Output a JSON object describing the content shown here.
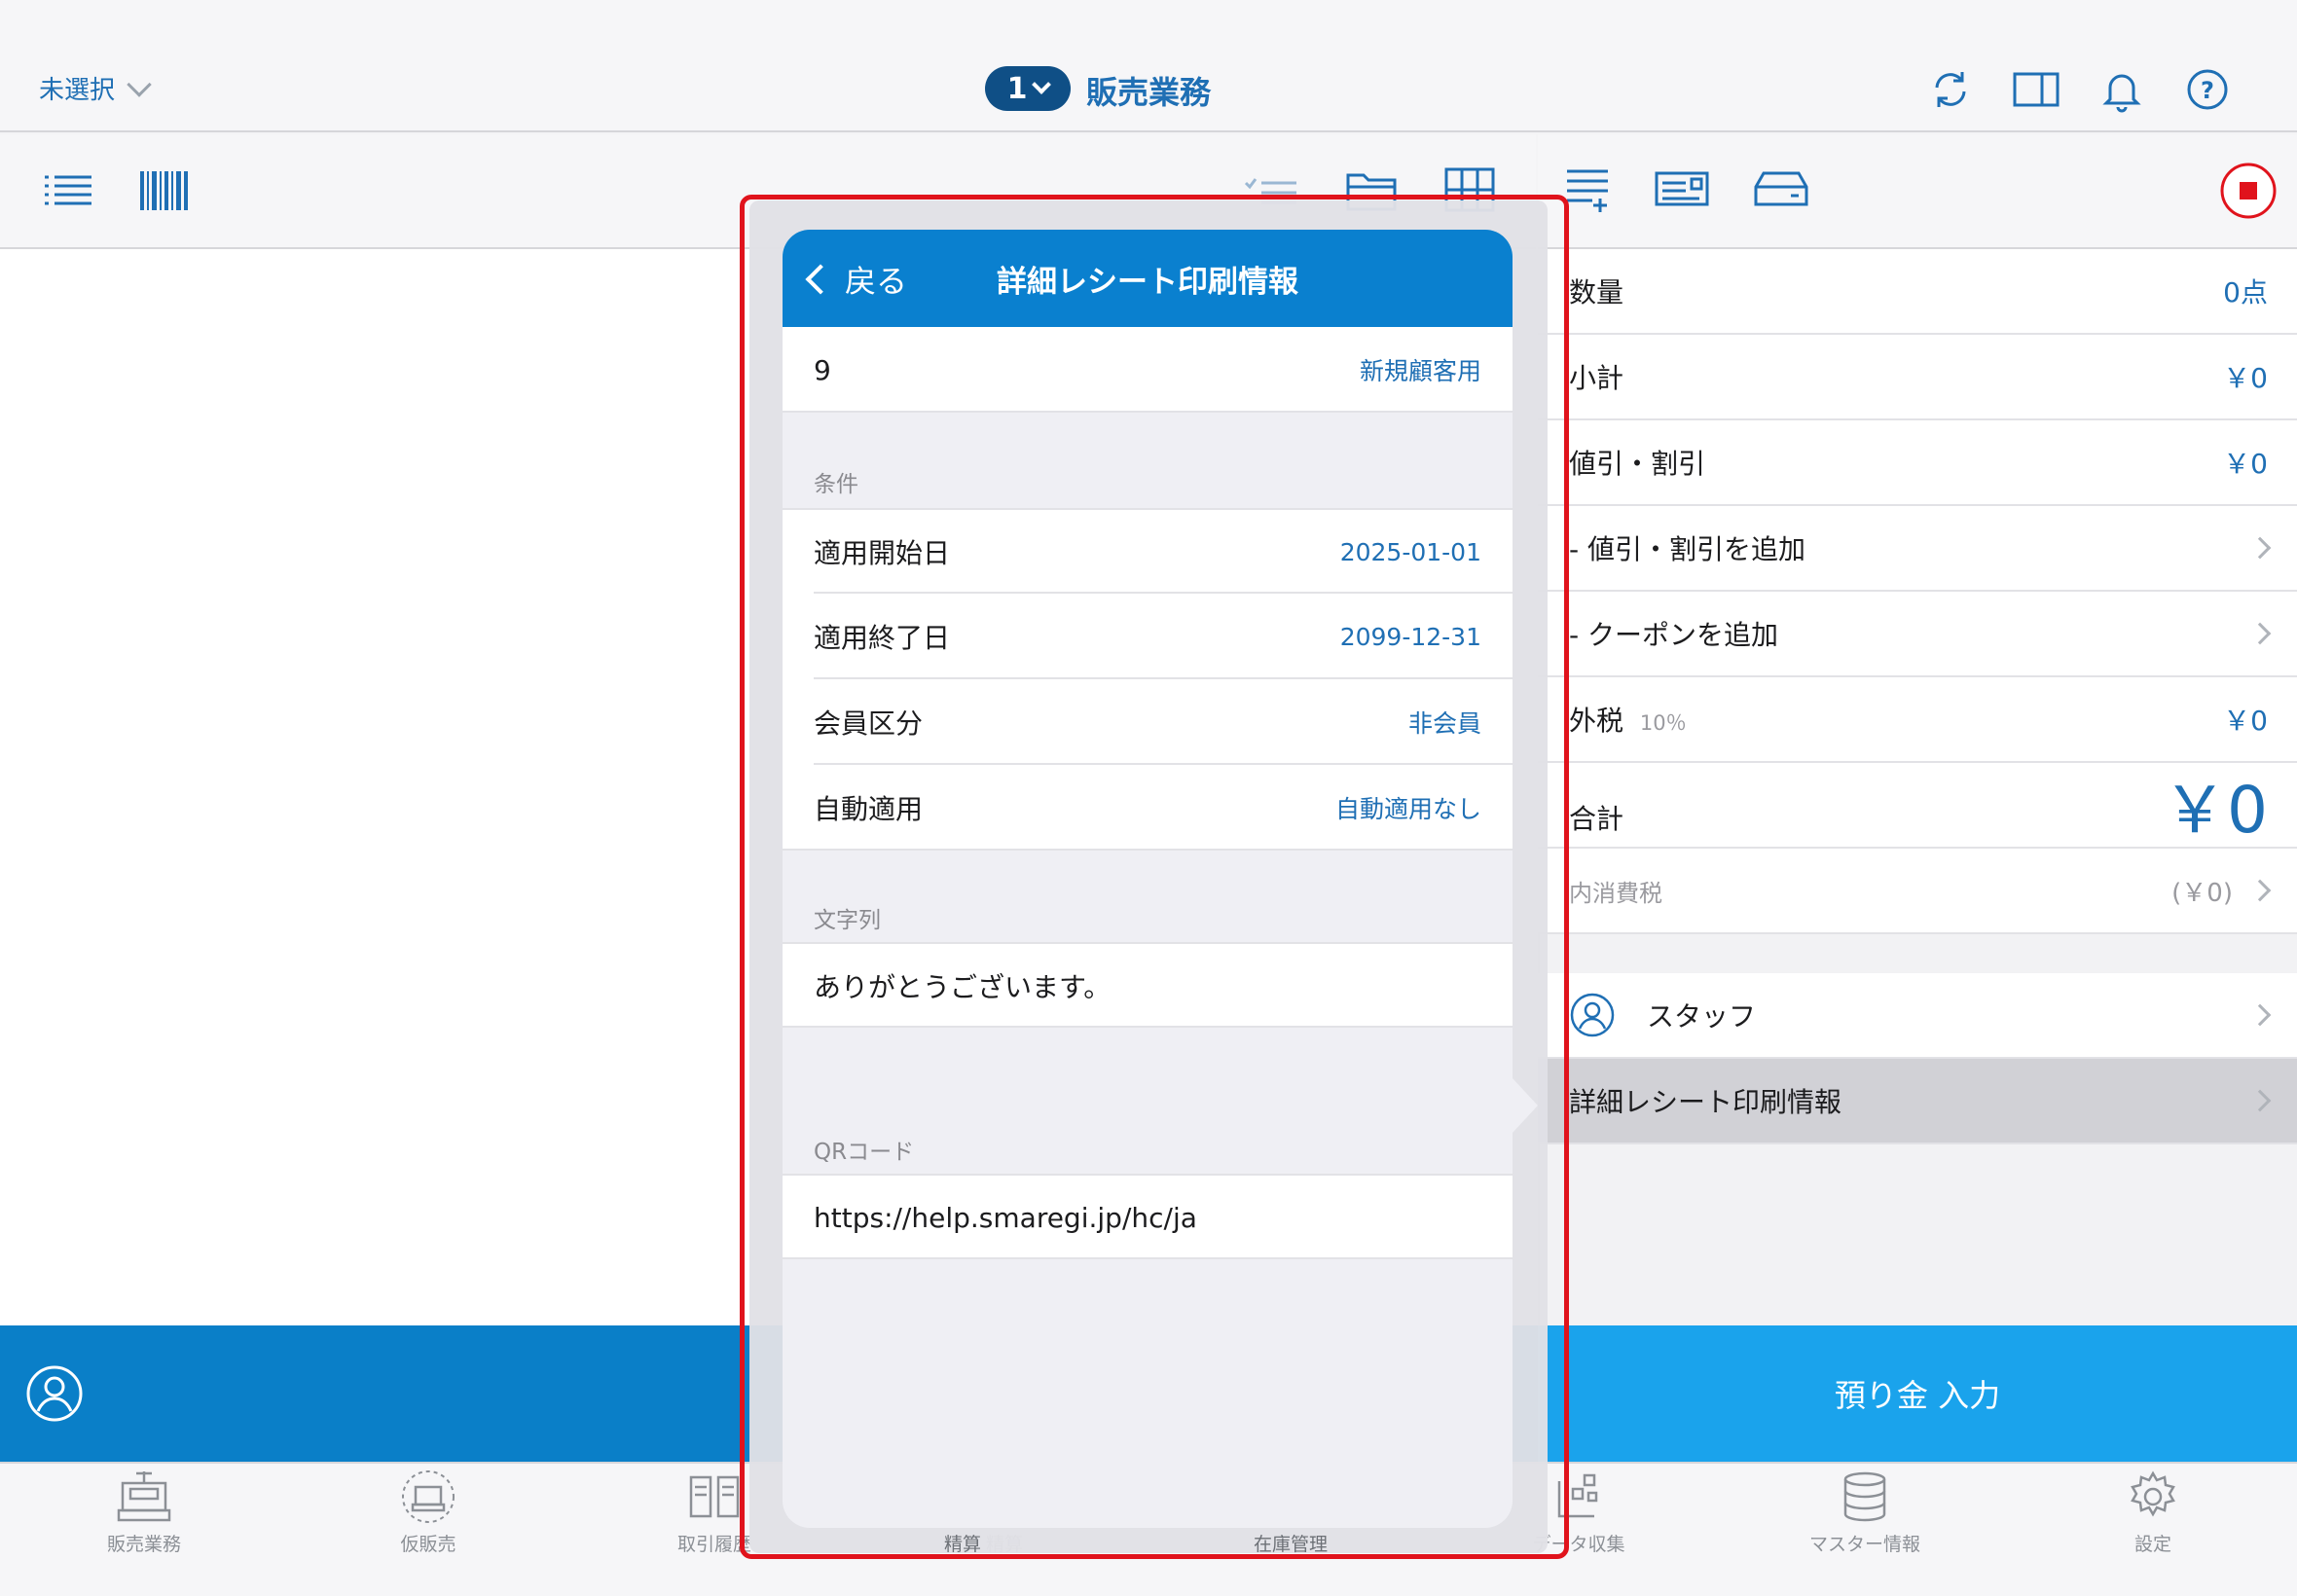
{
  "topbar": {
    "store_label": "未選択",
    "register_number": "1",
    "page_title": "販売業務",
    "icons": [
      "refresh-icon",
      "split-view-icon",
      "bell-icon",
      "help-icon"
    ]
  },
  "left_toolbar": {
    "icons": [
      "list-icon",
      "barcode-icon",
      "checklist-icon",
      "folder-icon",
      "grid-icon"
    ]
  },
  "right_toolbar": {
    "icons": [
      "add-line-icon",
      "card-icon",
      "drawer-icon",
      "stop-icon"
    ]
  },
  "summary": {
    "quantity_label": "数量",
    "quantity_value": "0点",
    "subtotal_label": "小計",
    "subtotal_value": "￥0",
    "discount_label": "値引・割引",
    "discount_value": "￥0",
    "add_discount_label": "- 値引・割引を追加",
    "add_coupon_label": "- クーポンを追加",
    "tax_label": "外税",
    "tax_rate": "10％",
    "tax_value": "￥0",
    "total_label": "合計",
    "total_value": "￥0",
    "inner_tax_label": "内消費税",
    "inner_tax_value": "(￥0)",
    "staff_label": "スタッフ",
    "receipt_info_label": "詳細レシート印刷情報"
  },
  "deposit_button": "預り金 入力",
  "tabs": [
    {
      "label": "販売業務",
      "icon": "register-icon"
    },
    {
      "label": "仮販売",
      "icon": "temp-sale-icon"
    },
    {
      "label": "取引履歴",
      "icon": "history-icon"
    },
    {
      "label": "精算",
      "icon": "settlement-icon"
    },
    {
      "label": "在庫管理",
      "icon": "inventory-icon"
    },
    {
      "label": "データ収集",
      "icon": "data-collect-icon"
    },
    {
      "label": "マスター情報",
      "icon": "database-icon"
    },
    {
      "label": "設定",
      "icon": "gear-icon"
    }
  ],
  "popover": {
    "back_label": "戻る",
    "title": "詳細レシート印刷情報",
    "id_value": "9",
    "id_tag": "新規顧客用",
    "section_conditions": "条件",
    "start_label": "適用開始日",
    "start_value": "2025-01-01",
    "end_label": "適用終了日",
    "end_value": "2099-12-31",
    "member_label": "会員区分",
    "member_value": "非会員",
    "auto_label": "自動適用",
    "auto_value": "自動適用なし",
    "section_text": "文字列",
    "text_value": "ありがとうございます。",
    "section_qr": "QRコード",
    "qr_value": "https://help.smaregi.jp/hc/ja"
  },
  "colors": {
    "accent": "#0a80cf",
    "bottom_bar": "#0a7fc8",
    "deposit": "#1aa3ec",
    "highlight_frame": "#e0131c"
  }
}
